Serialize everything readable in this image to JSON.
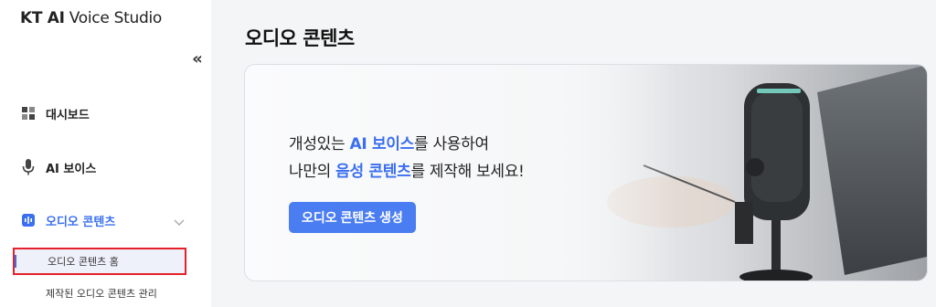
{
  "sidebar": {
    "logo": {
      "prefix": "KT AI",
      "suffix": " Voice Studio"
    },
    "collapse_glyph": "«",
    "items": [
      {
        "label": "대시보드",
        "icon": "dashboard-grid-icon"
      },
      {
        "label": "AI 보이스",
        "icon": "microphone-icon"
      },
      {
        "label": "오디오 콘텐츠",
        "icon": "audio-content-icon",
        "active": true,
        "expanded": true
      }
    ],
    "sub_items": [
      {
        "label": "오디오 콘텐츠 홈",
        "selected": true
      },
      {
        "label": "제작된 오디오 콘텐츠 관리"
      }
    ]
  },
  "main": {
    "title": "오디오 콘텐츠",
    "banner": {
      "line1_pre": "개성있는 ",
      "line1_hl": "AI 보이스",
      "line1_post": "를 사용하여",
      "line2_pre": "나만의 ",
      "line2_hl": "음성 콘텐츠",
      "line2_post": "를 제작해 보세요!",
      "cta_label": "오디오 콘텐츠 생성"
    }
  },
  "colors": {
    "accent": "#3b6ff0",
    "button": "#4a7df2",
    "highlight_border": "#e5212b",
    "selected_bg": "#eef1fa"
  }
}
